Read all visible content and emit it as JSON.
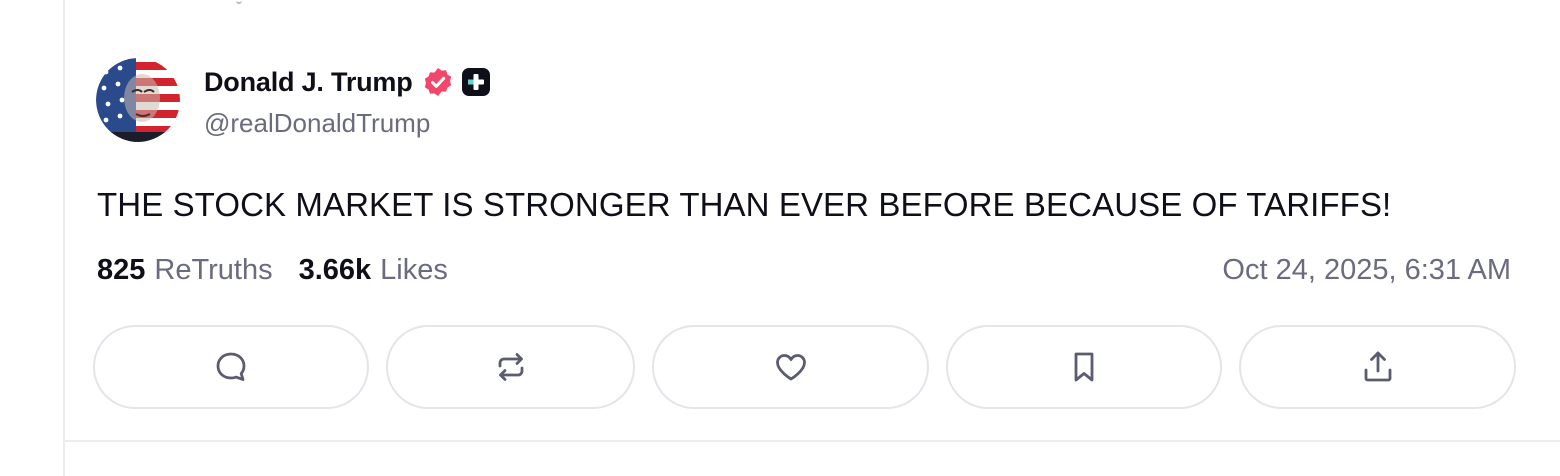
{
  "post": {
    "author": {
      "display_name": "Donald J. Trump",
      "handle": "@realDonaldTrump",
      "verified_badge_color": "#f0476a",
      "avatar_icon": "avatar-flag-portrait"
    },
    "text": "THE STOCK MARKET IS STRONGER THAN EVER BEFORE BECAUSE OF TARIFFS!",
    "stats": {
      "retruths_count": "825",
      "retruths_label": "ReTruths",
      "likes_count": "3.66k",
      "likes_label": "Likes"
    },
    "timestamp": "Oct 24, 2025, 6:31 AM",
    "actions": [
      {
        "name": "reply",
        "icon": "comment-icon"
      },
      {
        "name": "retruth",
        "icon": "repost-icon"
      },
      {
        "name": "like",
        "icon": "heart-icon"
      },
      {
        "name": "bookmark",
        "icon": "bookmark-icon"
      },
      {
        "name": "share",
        "icon": "share-icon"
      }
    ]
  },
  "colors": {
    "text_primary": "#0f0f1a",
    "text_secondary": "#6b6b80",
    "border": "#e4e4ea",
    "icon": "#5c5c70"
  }
}
